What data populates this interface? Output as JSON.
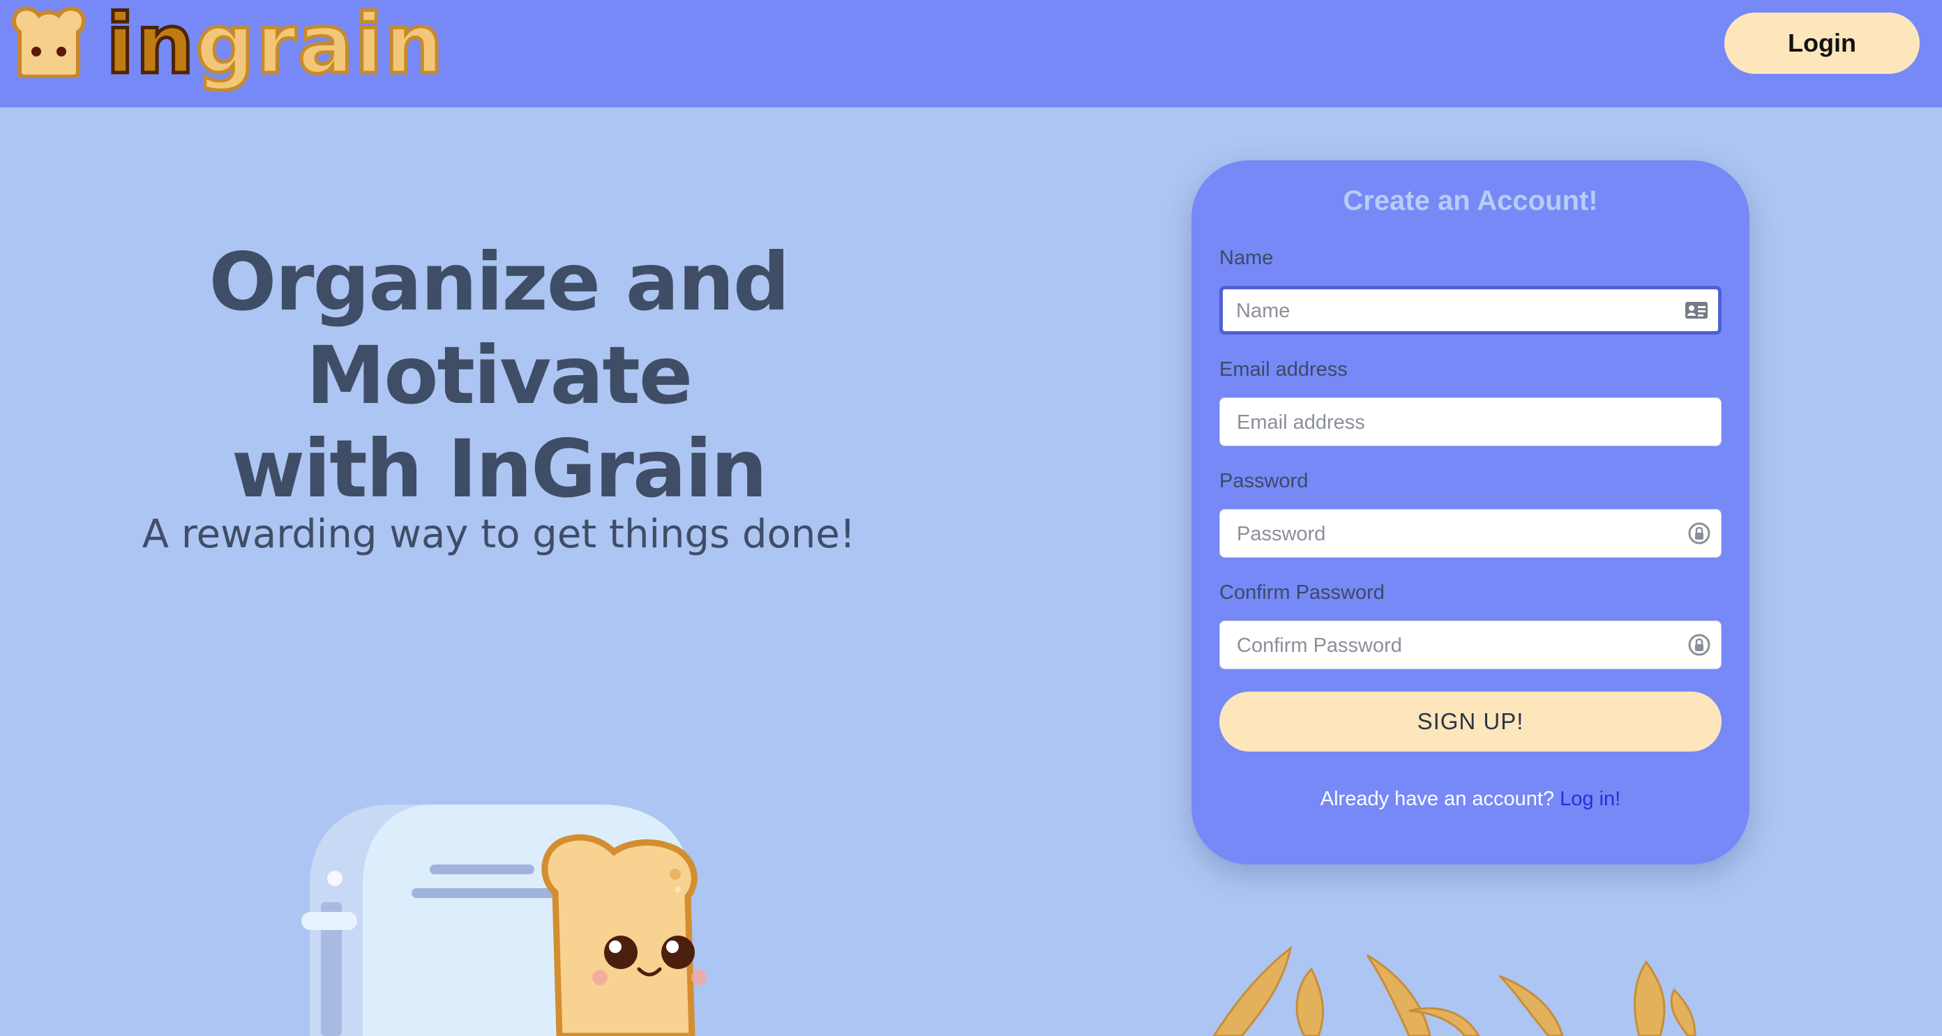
{
  "header": {
    "logo_text_dark": "in",
    "logo_text_light": "grain",
    "login_label": "Login"
  },
  "hero": {
    "title_line1": "Organize and Motivate",
    "title_line2": "with InGrain",
    "subtitle": "A rewarding way to get things done!"
  },
  "signup_form": {
    "title": "Create an Account!",
    "fields": [
      {
        "label": "Name",
        "placeholder": "Name",
        "value": "",
        "icon": "contact-card-icon",
        "focused": true
      },
      {
        "label": "Email address",
        "placeholder": "Email address",
        "value": "",
        "icon": null
      },
      {
        "label": "Password",
        "placeholder": "Password",
        "value": "",
        "icon": "password-key-icon"
      },
      {
        "label": "Confirm Password",
        "placeholder": "Confirm Password",
        "value": "",
        "icon": "password-key-icon"
      }
    ],
    "submit_label": "SIGN UP!",
    "footer_text": "Already have an account?",
    "footer_link": "Log in!"
  },
  "colors": {
    "header_bg": "#7689f7",
    "page_bg": "#adc5f2",
    "card_bg": "#7689f7",
    "button_bg": "#fde6bb",
    "link": "#2331d9",
    "heading_text": "#3f4d66"
  }
}
